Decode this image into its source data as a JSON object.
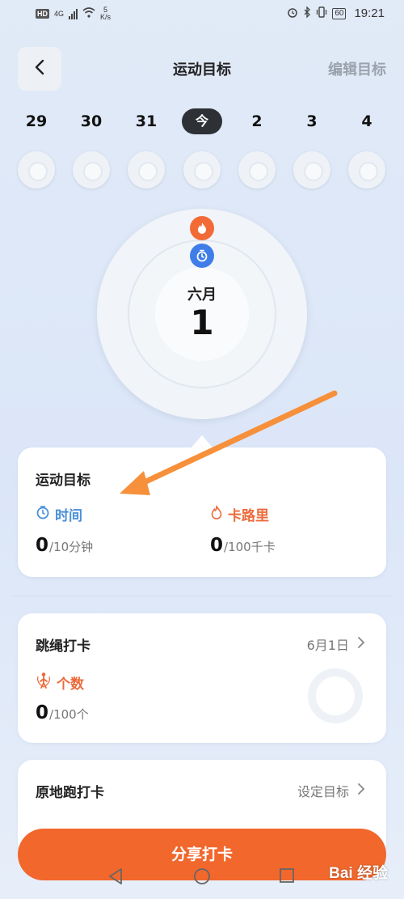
{
  "status_bar": {
    "hd": "HD",
    "network": "4G",
    "speed_value": "5",
    "speed_unit": "K/s",
    "battery": "60",
    "time": "19:21"
  },
  "header": {
    "title": "运动目标",
    "edit_label": "编辑目标"
  },
  "date_strip": {
    "dates": [
      "29",
      "30",
      "31",
      "今",
      "2",
      "3",
      "4"
    ],
    "selected_index": 3
  },
  "dial": {
    "month": "六月",
    "day": "1"
  },
  "goal_card": {
    "title": "运动目标",
    "time": {
      "label": "时间",
      "value": "0",
      "unit": "/10分钟"
    },
    "calories": {
      "label": "卡路里",
      "value": "0",
      "unit": "/100千卡"
    }
  },
  "jump_card": {
    "title": "跳绳打卡",
    "date": "6月1日",
    "metric_label": "个数",
    "value": "0",
    "unit": "/100个"
  },
  "run_card": {
    "title": "原地跑打卡",
    "action": "设定目标"
  },
  "share_button": "分享打卡",
  "watermark": "Bai 经验",
  "colors": {
    "accent_orange": "#f1672c",
    "time_blue": "#4a8fd9",
    "calorie_orange": "#ec6a3a",
    "background": "#dbe6f8"
  },
  "icons": [
    "back-chevron-icon",
    "flame-icon",
    "stopwatch-icon",
    "jump-rope-icon",
    "chevron-right-icon"
  ]
}
